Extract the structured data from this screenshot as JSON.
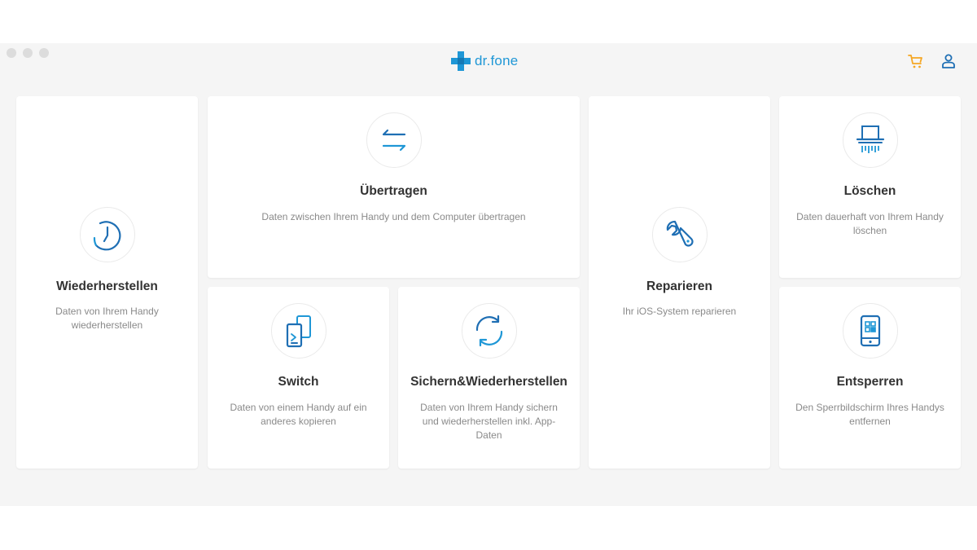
{
  "app": {
    "logo_text": "dr.fone",
    "brand_color": "#1f97d6",
    "accent_color": "#f5a623"
  },
  "header": {
    "icons": [
      "cart-icon",
      "user-icon"
    ]
  },
  "cards": [
    {
      "id": "restore",
      "icon": "clock-icon",
      "title": "Wiederherstellen",
      "desc": "Daten von Ihrem Handy wiederherstellen"
    },
    {
      "id": "transfer",
      "icon": "transfer-arrows-icon",
      "title": "Übertragen",
      "desc": "Daten zwischen Ihrem Handy und dem Computer übertragen"
    },
    {
      "id": "switch",
      "icon": "phone-switch-icon",
      "title": "Switch",
      "desc": "Daten von einem Handy auf ein anderes kopieren"
    },
    {
      "id": "backup",
      "icon": "sync-icon",
      "title": "Sichern&Wiederherstellen",
      "desc": "Daten von Ihrem Handy sichern und wiederherstellen inkl. App-Daten"
    },
    {
      "id": "repair",
      "icon": "wrench-icon",
      "title": "Reparieren",
      "desc": "Ihr iOS-System reparieren"
    },
    {
      "id": "erase",
      "icon": "shredder-icon",
      "title": "Löschen",
      "desc": "Daten dauerhaft von Ihrem Handy löschen"
    },
    {
      "id": "unlock",
      "icon": "phone-unlock-icon",
      "title": "Entsperren",
      "desc": "Den Sperrbildschirm Ihres Handys entfernen"
    }
  ]
}
